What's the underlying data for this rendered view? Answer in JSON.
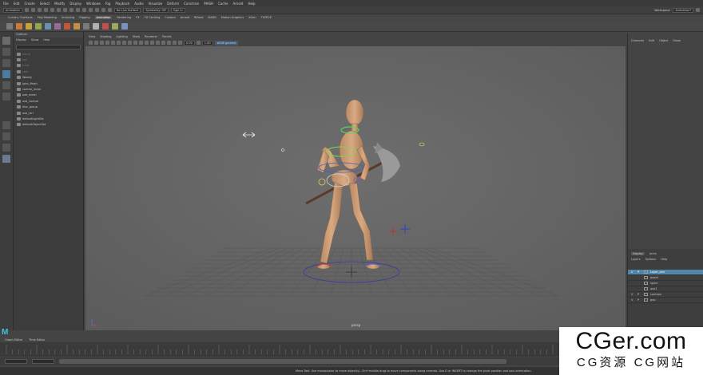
{
  "menubar": [
    "File",
    "Edit",
    "Create",
    "Select",
    "Modify",
    "Display",
    "Windows",
    "Rig",
    "Playback",
    "Audio",
    "Visualize",
    "Deform",
    "Constrain",
    "MASH",
    "Cache",
    "Arnold",
    "Help"
  ],
  "workspace": {
    "label": "Workspace:",
    "value": "Animation*"
  },
  "status": {
    "mode": "Animation",
    "no_live": "No Live Surface",
    "symmetry": "Symmetry: Off",
    "sign_in": "Sign In"
  },
  "shelf_tabs": [
    "Curves / Surfaces",
    "Poly Modeling",
    "Sculpting",
    "Rigging",
    "Animation",
    "Rendering",
    "FX",
    "FX Caching",
    "Custom",
    "Arnold",
    "Bifrost",
    "MASH",
    "Motion Graphics",
    "XGen",
    "TURTLE"
  ],
  "outliner": {
    "title": "Outliner",
    "menu": [
      "Display",
      "Show",
      "Help"
    ],
    "items": [
      {
        "label": "persp",
        "dim": true
      },
      {
        "label": "top",
        "dim": true
      },
      {
        "label": "front",
        "dim": true
      },
      {
        "label": "side",
        "dim": true
      },
      {
        "label": "Woody",
        "dim": false
      },
      {
        "label": "Joint_Mesh",
        "dim": false
      },
      {
        "label": "control_mesh",
        "dim": false
      },
      {
        "label": "axe_mesh",
        "dim": false
      },
      {
        "label": "axe_control",
        "dim": false
      },
      {
        "label": "disc_group",
        "dim": false
      },
      {
        "label": "axe_ctrl",
        "dim": false
      },
      {
        "label": "defaultLightSet",
        "dim": false
      },
      {
        "label": "defaultObjectSet",
        "dim": false
      }
    ]
  },
  "viewport": {
    "menu": [
      "View",
      "Shading",
      "Lighting",
      "Show",
      "Renderer",
      "Panels"
    ],
    "field1": "0.00",
    "field2": "1.00",
    "colorspace": "sRGB gamma",
    "camera_label": "persp"
  },
  "channel_box": {
    "menu": [
      "Channels",
      "Edit",
      "Object",
      "Show"
    ]
  },
  "layers": {
    "tabs": [
      "Display",
      "Anim"
    ],
    "menu": [
      "Layers",
      "Options",
      "Help"
    ],
    "rows": [
      {
        "v": "V",
        "p": "P",
        "label": "Layer_aim",
        "sel": true
      },
      {
        "v": "",
        "p": "",
        "label": "base1"
      },
      {
        "v": "",
        "p": "",
        "label": "spine"
      },
      {
        "v": "",
        "p": "",
        "label": "axe1"
      },
      {
        "v": "V",
        "p": "P",
        "label": "controls"
      },
      {
        "v": "V",
        "p": "P",
        "label": "geo"
      }
    ]
  },
  "timeline_tabs": [
    "Graph Editor",
    "Time Editor"
  ],
  "help_line": "Move Tool: Use manipulator to move object(s). Ctrl+middle-drag to move components along normals. Use D or INSERT to change the pivot position and axis orientation.",
  "watermark": {
    "big": "CGer.com",
    "small": "CG资源 CG网站"
  },
  "colors": {
    "accent": "#3fc4d8",
    "select": "#5286a8"
  }
}
